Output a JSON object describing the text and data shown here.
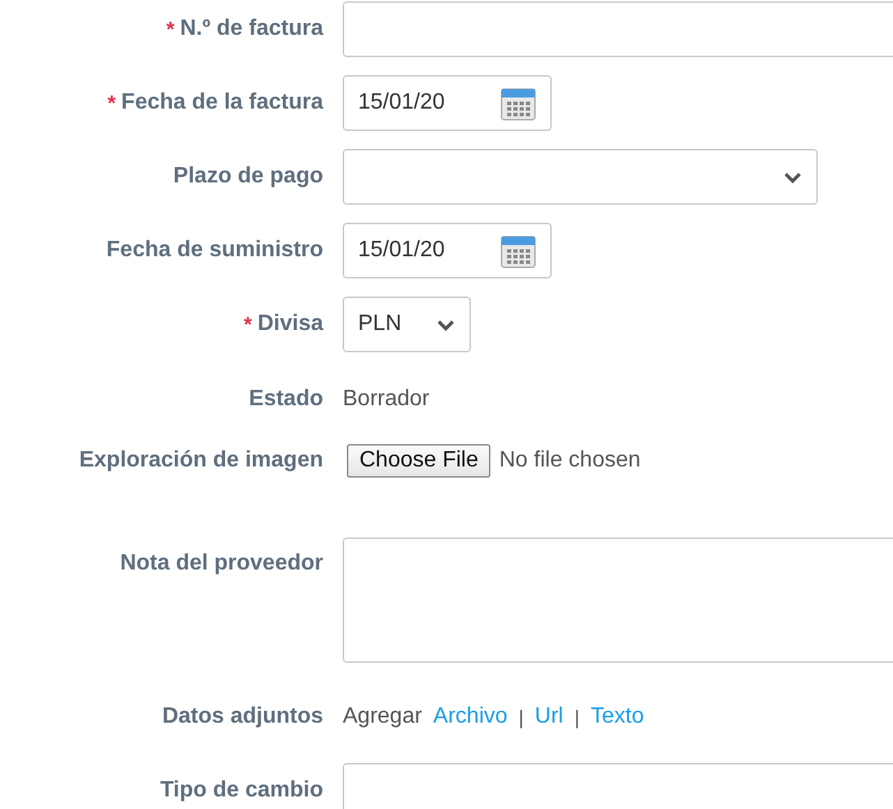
{
  "fields": [
    {
      "kind": "text",
      "label": "N.º de factura",
      "required": true
    },
    {
      "kind": "date",
      "label": "Fecha de la factura",
      "required": true,
      "value": "15/01/20"
    },
    {
      "kind": "select",
      "label": "Plazo de pago",
      "required": false
    },
    {
      "kind": "date",
      "label": "Fecha de suministro",
      "required": false,
      "value": "15/01/20"
    },
    {
      "kind": "currency",
      "label": "Divisa",
      "required": true,
      "value": "PLN"
    },
    {
      "kind": "static",
      "label": "Estado",
      "required": false,
      "value": "Borrador"
    },
    {
      "kind": "file",
      "label": "Exploración de imagen",
      "required": false,
      "button": "Choose File",
      "status": "No file chosen"
    },
    {
      "kind": "textarea",
      "label": "Nota del proveedor",
      "required": false
    },
    {
      "kind": "attachments",
      "label": "Datos adjuntos",
      "required": false,
      "prefix": "Agregar",
      "links": [
        "Archivo",
        "Url",
        "Texto"
      ],
      "separator": "|"
    },
    {
      "kind": "text",
      "label": "Tipo de cambio",
      "required": false
    }
  ],
  "required_mark": "*"
}
